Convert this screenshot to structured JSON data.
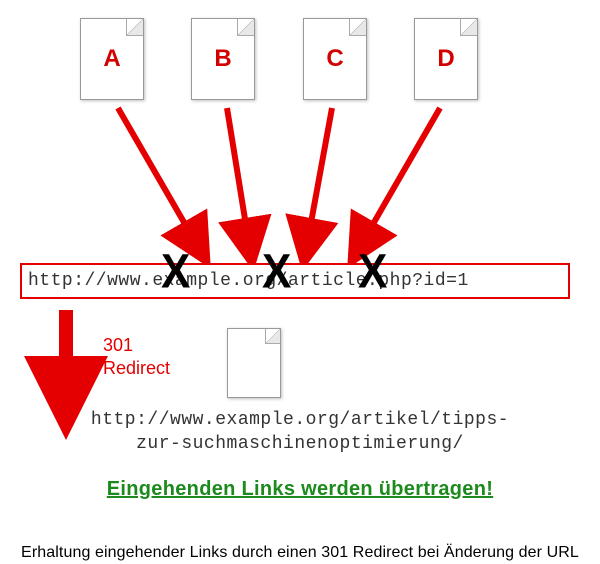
{
  "docs": {
    "a": "A",
    "b": "B",
    "c": "C",
    "d": "D"
  },
  "old_url": "http://www.example.org/article.php?id=1",
  "redirect_label_line1": "301",
  "redirect_label_line2": "Redirect",
  "new_url_line1": "http://www.example.org/artikel/tipps-",
  "new_url_line2": "zur-suchmaschinenoptimierung/",
  "green_message": "Eingehenden Links werden übertragen!",
  "caption": "Erhaltung eingehender Links durch einen 301 Redirect bei Änderung der URL",
  "colors": {
    "accent": "#e40000",
    "success": "#1c8a1c"
  }
}
